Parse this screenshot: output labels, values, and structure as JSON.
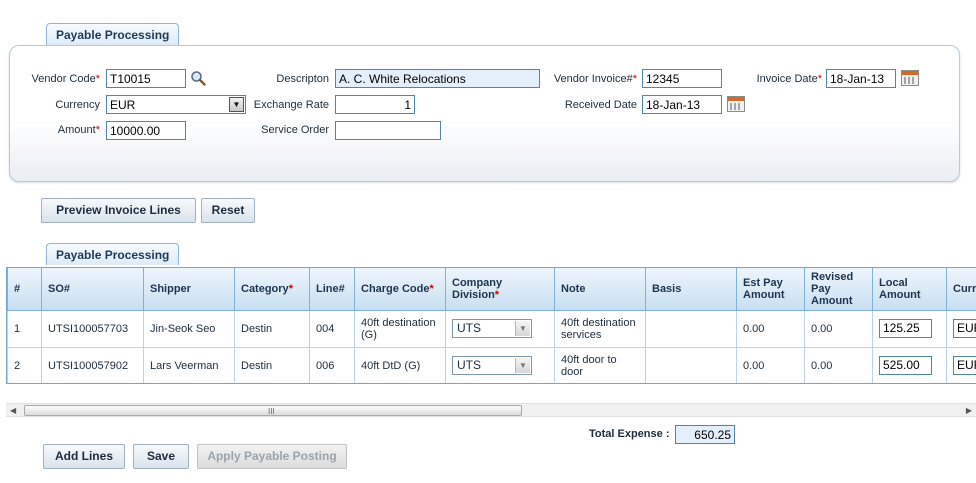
{
  "header_tab": {
    "label": "Payable Processing"
  },
  "form": {
    "vendor_code": {
      "label": "Vendor Code",
      "value": "T10015"
    },
    "currency": {
      "label": "Currency",
      "value": "EUR"
    },
    "amount": {
      "label": "Amount",
      "value": "10000.00"
    },
    "description": {
      "label": "Descripton",
      "value": "A. C. White Relocations"
    },
    "exchange_rate": {
      "label": "Exchange Rate",
      "value": "1"
    },
    "service_order": {
      "label": "Service Order",
      "value": ""
    },
    "vendor_invoice": {
      "label": "Vendor Invoice#",
      "value": "12345"
    },
    "received_date": {
      "label": "Received Date",
      "value": "18-Jan-13"
    },
    "invoice_date": {
      "label": "Invoice Date",
      "value": "18-Jan-13"
    }
  },
  "actions": {
    "preview_label": "Preview Invoice Lines",
    "reset_label": "Reset"
  },
  "lines_tab": {
    "label": "Payable Processing"
  },
  "grid": {
    "headers": {
      "num": "#",
      "so": "SO#",
      "shipper": "Shipper",
      "category": "Category",
      "line": "Line#",
      "charge_code": "Charge Code",
      "company_division": "Company Division",
      "note": "Note",
      "basis": "Basis",
      "est_pay": "Est Pay Amount",
      "revised_pay": "Revised Pay Amount",
      "local_amount": "Local Amount",
      "currency": "Curre"
    },
    "rows": [
      {
        "num": "1",
        "so": "UTSI100057703",
        "shipper": "Jin-Seok Seo",
        "category": "Destin",
        "line": "004",
        "charge_code": "40ft destination (G)",
        "division": "UTS",
        "note": "40ft destination services",
        "basis": "",
        "est_pay": "0.00",
        "revised_pay": "0.00",
        "local_amount": "125.25",
        "currency": "EUR"
      },
      {
        "num": "2",
        "so": "UTSI100057902",
        "shipper": "Lars Veerman",
        "category": "Destin",
        "line": "006",
        "charge_code": "40ft DtD (G)",
        "division": "UTS",
        "note": "40ft door to door",
        "basis": "",
        "est_pay": "0.00",
        "revised_pay": "0.00",
        "local_amount": "525.00",
        "currency": "EUR"
      }
    ]
  },
  "scrollbar": {
    "grip": "III"
  },
  "total": {
    "label": "Total Expense :",
    "value": "650.25"
  },
  "footer": {
    "add_lines_label": "Add Lines",
    "save_label": "Save",
    "apply_label": "Apply Payable Posting"
  },
  "icons": {
    "lookup": "magnifier-icon",
    "calendar": "calendar-icon"
  }
}
